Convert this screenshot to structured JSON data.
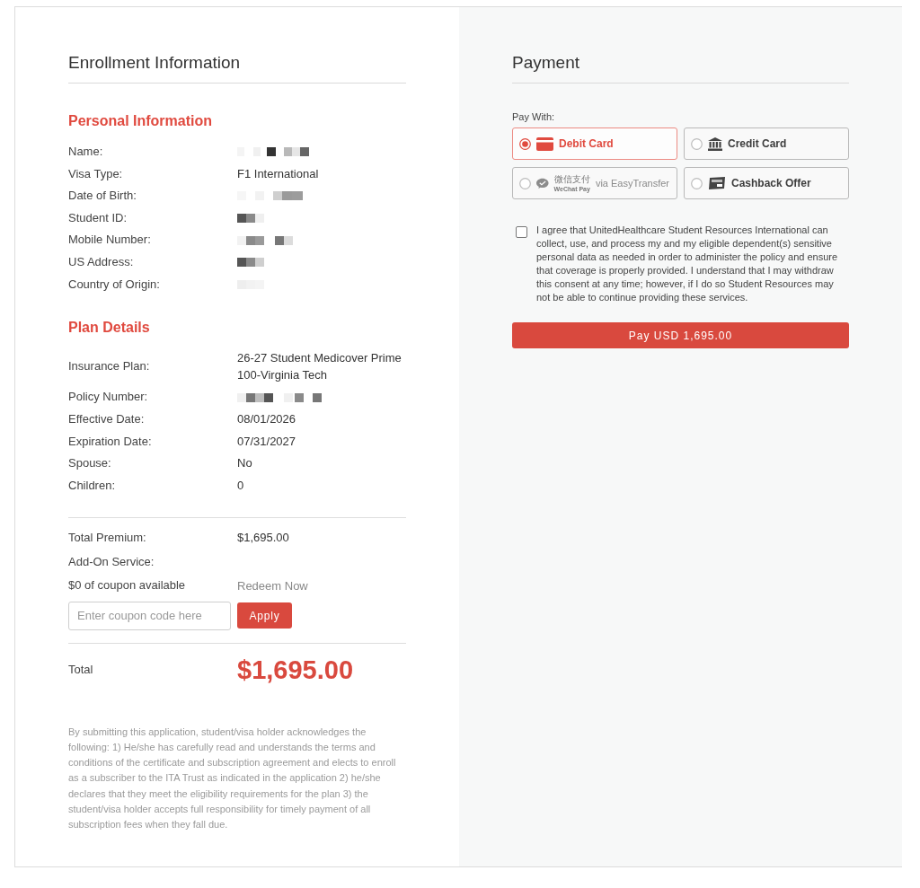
{
  "enrollment": {
    "title": "Enrollment Information",
    "sections": [
      {
        "heading": "Personal Information",
        "rows": [
          {
            "label": "Name:",
            "kind": "redacted"
          },
          {
            "label": "Visa Type:",
            "kind": "text",
            "value": "F1 International"
          },
          {
            "label": "Date of Birth:",
            "kind": "redacted"
          },
          {
            "label": "Student ID:",
            "kind": "redacted"
          },
          {
            "label": "Mobile Number:",
            "kind": "redacted"
          },
          {
            "label": "US Address:",
            "kind": "redacted"
          },
          {
            "label": "Country of Origin:",
            "kind": "redacted"
          }
        ]
      },
      {
        "heading": "Plan Details",
        "rows": [
          {
            "label": "Insurance Plan:",
            "kind": "text",
            "value": "26-27 Student Medicover Prime 100-Virginia Tech"
          },
          {
            "label": "Policy Number:",
            "kind": "redacted"
          },
          {
            "label": "Effective Date:",
            "kind": "text",
            "value": "08/01/2026"
          },
          {
            "label": "Expiration Date:",
            "kind": "text",
            "value": "07/31/2027"
          },
          {
            "label": "Spouse:",
            "kind": "text",
            "value": "No"
          },
          {
            "label": "Children:",
            "kind": "text",
            "value": "0"
          }
        ]
      }
    ],
    "summary": {
      "rows": [
        {
          "label": "Total Premium:",
          "value": "$1,695.00"
        },
        {
          "label": "Add-On Service:"
        }
      ],
      "coupon": {
        "label": "$0 of coupon available",
        "link": "Redeem Now",
        "placeholder": "Enter coupon code here",
        "button": "Apply"
      },
      "total": {
        "label": "Total",
        "value": "$1,695.00"
      }
    },
    "disclaimer": "By submitting this application, student/visa holder acknowledges the following: 1) He/she has carefully read and understands the terms and conditions of the certificate and subscription agreement and elects to enroll as a subscriber to the ITA Trust as indicated in the application 2) he/she declares that they meet the eligibility requirements for the plan 3) the student/visa holder accepts full responsibility for timely payment of all subscription fees when they fall due."
  },
  "payment": {
    "title": "Payment",
    "pay_with_label": "Pay With:",
    "methods": [
      {
        "kind": "debit",
        "label": "Debit Card",
        "selected": true
      },
      {
        "kind": "bank",
        "label": "Credit Card",
        "selected": false
      },
      {
        "kind": "wechat",
        "logo_text": "微信支付",
        "logo_subtext": "WeChat Pay",
        "note": "via EasyTransfer",
        "selected": false
      },
      {
        "kind": "cashback",
        "label": "Cashback Offer",
        "selected": false
      }
    ],
    "consent": {
      "checked": false,
      "text": "I agree that UnitedHealthcare Student Resources International can collect, use, and process my and my eligible dependent(s) sensitive personal data as needed in order to administer the policy and ensure that coverage is properly provided. I understand that I may withdraw this consent at any time; however, if I do so Student Resources may not be able to continue providing these services."
    },
    "pay_button": "Pay USD 1,695.00"
  }
}
